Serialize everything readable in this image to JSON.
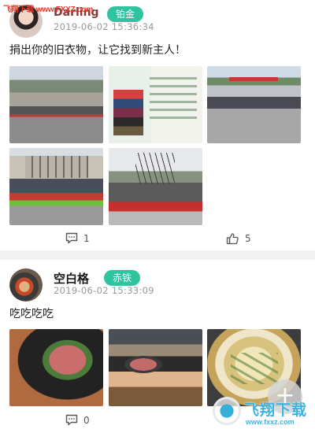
{
  "watermark_top": "飞翔下载 www.FXXZ.com",
  "posts": [
    {
      "username": "Darling",
      "badge": "铂金",
      "time": "2019-06-02 15:36:34",
      "content": "捐出你的旧衣物，让它找到新主人！",
      "comment_count": "1",
      "like_count": "5"
    },
    {
      "username": "空白格",
      "badge": "赤铁",
      "time": "2019-06-02 15:33:09",
      "content": "吃吃吃吃",
      "comment_count": "0"
    }
  ],
  "fab_label": "+",
  "watermark_bottom": {
    "text": "飞翔下载",
    "url": "www.fxxz.com"
  },
  "colors": {
    "accent": "#2fc4a0",
    "divider": "#f2f2f2"
  },
  "icons": [
    "comment-icon",
    "thumbs-up-icon",
    "plus-icon"
  ]
}
